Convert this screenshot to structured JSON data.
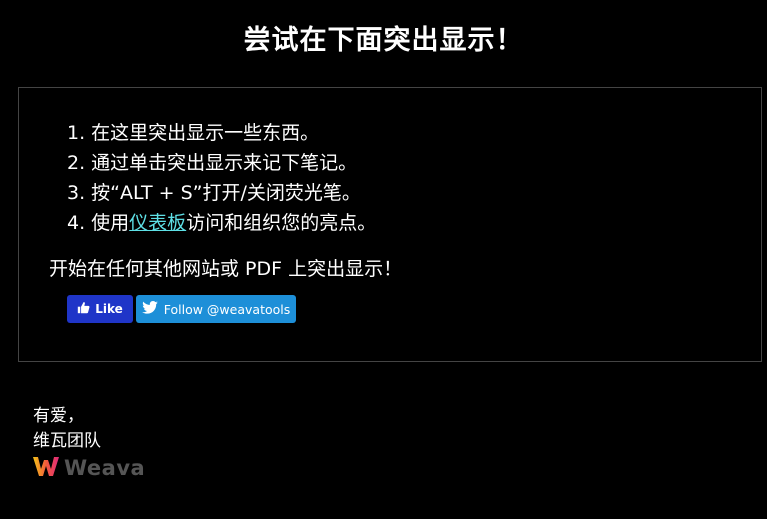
{
  "header": {
    "title": "尝试在下面突出显示！"
  },
  "steps": [
    {
      "text": "1. 在这里突出显示一些东西。"
    },
    {
      "text": "2. 通过单击突出显示来记下笔记。"
    },
    {
      "text": "3. 按“ALT + S”打开/关闭荧光笔。"
    },
    {
      "prefix": "4. 使用",
      "link": "仪表板",
      "suffix": "访问和组织您的亮点。"
    }
  ],
  "cta_text": "开始在任何其他网站或 PDF 上突出显示！",
  "buttons": {
    "like": {
      "label": "Like",
      "icon": "thumbs-up-icon"
    },
    "follow": {
      "label": "Follow @weavatools",
      "icon": "twitter-bird-icon"
    }
  },
  "signoff": {
    "line1": "有爱，",
    "line2": "维瓦团队"
  },
  "brand": {
    "name": "Weava",
    "icon": "weava-logo-icon"
  },
  "colors": {
    "background": "#000000",
    "link": "#5ee0e6",
    "like_button": "#1f35c8",
    "follow_button": "#1d8fd8",
    "brand_text": "#555555",
    "panel_border": "#444444"
  }
}
